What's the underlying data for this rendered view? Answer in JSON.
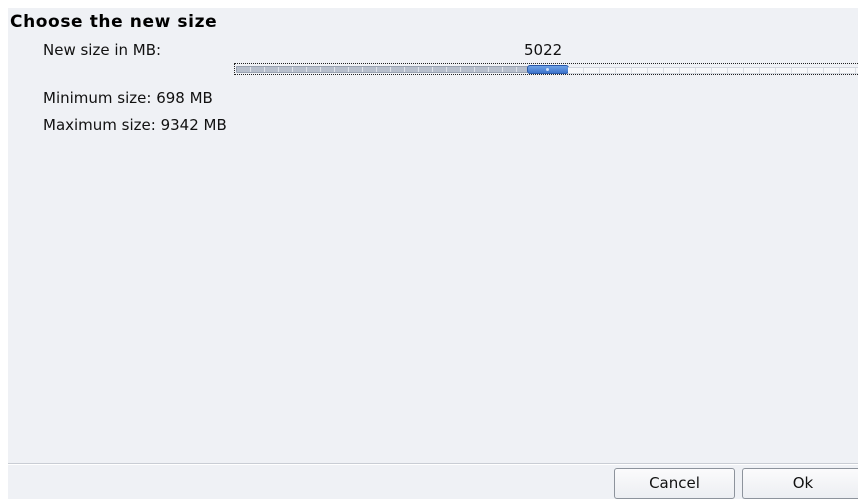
{
  "dialog": {
    "title": "Choose the new size"
  },
  "size": {
    "label": "New size in MB:",
    "value": "5022",
    "slider_min": 698,
    "slider_max": 9342,
    "slider_current": 5022,
    "accent_color": "#3d74cc"
  },
  "limits": {
    "minimum": "Minimum size: 698 MB",
    "maximum": "Maximum size: 9342 MB"
  },
  "buttons": {
    "cancel": "Cancel",
    "ok": "Ok"
  }
}
